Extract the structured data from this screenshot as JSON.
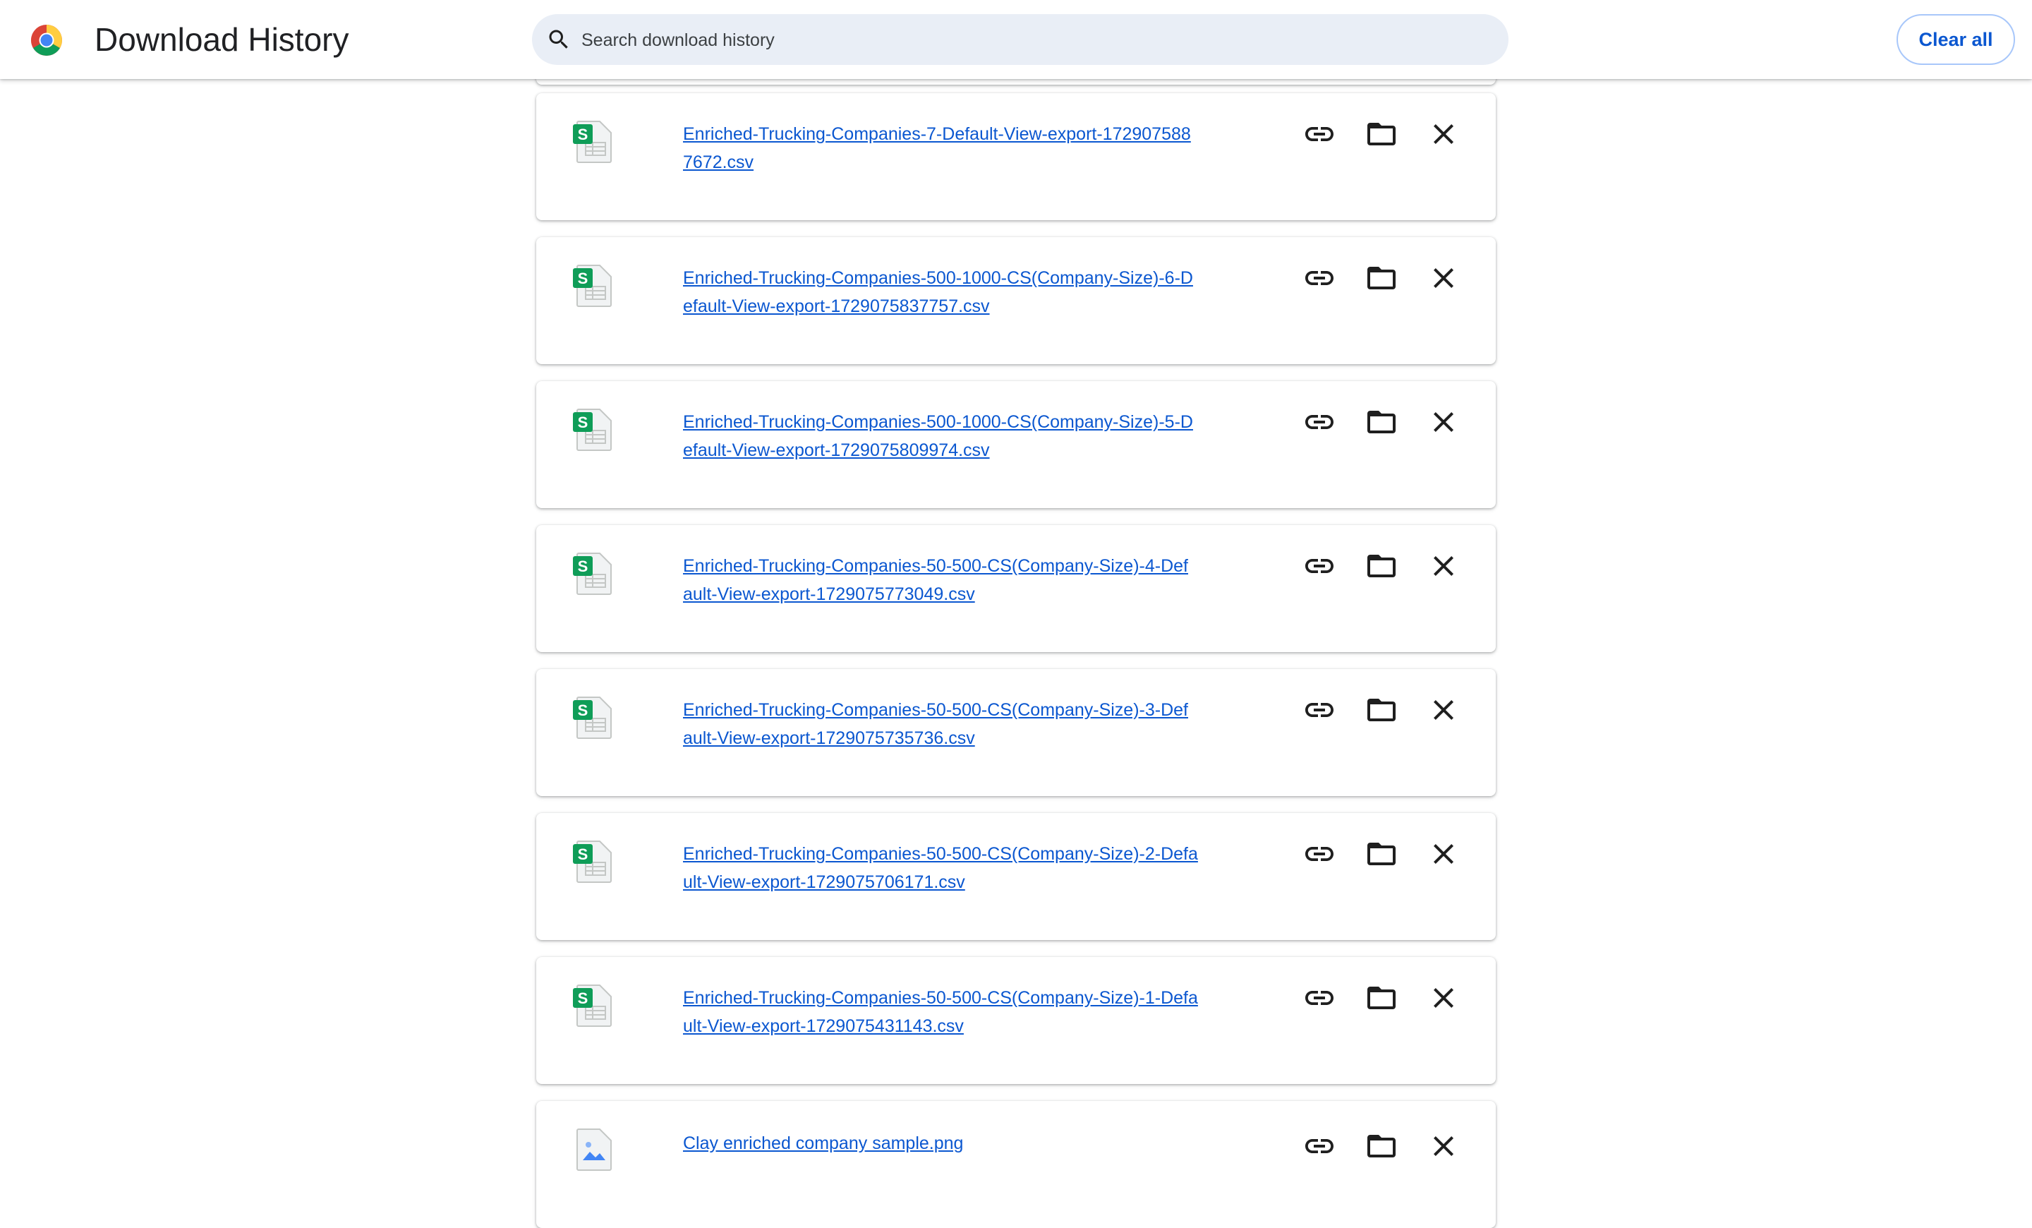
{
  "header": {
    "title": "Download History",
    "search_placeholder": "Search download history",
    "clear_all_label": "Clear all"
  },
  "icons": {
    "logo": "chrome-logo-icon",
    "search": "search-icon",
    "copy_link": "link-icon",
    "show_in_folder": "folder-icon",
    "remove": "close-icon",
    "sheet_file": "spreadsheet-file-icon",
    "image_file": "image-file-icon"
  },
  "colors": {
    "accent": "#0b57d0",
    "search_bg": "#e9eef6",
    "sheet_green": "#0f9d58"
  },
  "downloads": [
    {
      "filename_line1": "Enriched-Trucking-Companies-7-Default-View-export-172907588",
      "filename_line2": "7672.csv",
      "type": "csv"
    },
    {
      "filename_line1": "Enriched-Trucking-Companies-500-1000-CS(Company-Size)-6-D",
      "filename_line2": "efault-View-export-1729075837757.csv",
      "type": "csv"
    },
    {
      "filename_line1": "Enriched-Trucking-Companies-500-1000-CS(Company-Size)-5-D",
      "filename_line2": "efault-View-export-1729075809974.csv",
      "type": "csv"
    },
    {
      "filename_line1": "Enriched-Trucking-Companies-50-500-CS(Company-Size)-4-Def",
      "filename_line2": "ault-View-export-1729075773049.csv",
      "type": "csv"
    },
    {
      "filename_line1": "Enriched-Trucking-Companies-50-500-CS(Company-Size)-3-Def",
      "filename_line2": "ault-View-export-1729075735736.csv",
      "type": "csv"
    },
    {
      "filename_line1": "Enriched-Trucking-Companies-50-500-CS(Company-Size)-2-Defa",
      "filename_line2": "ult-View-export-1729075706171.csv",
      "type": "csv"
    },
    {
      "filename_line1": "Enriched-Trucking-Companies-50-500-CS(Company-Size)-1-Defa",
      "filename_line2": "ult-View-export-1729075431143.csv",
      "type": "csv"
    },
    {
      "filename_line1": "Clay enriched company sample.png",
      "filename_line2": "",
      "type": "png"
    }
  ]
}
